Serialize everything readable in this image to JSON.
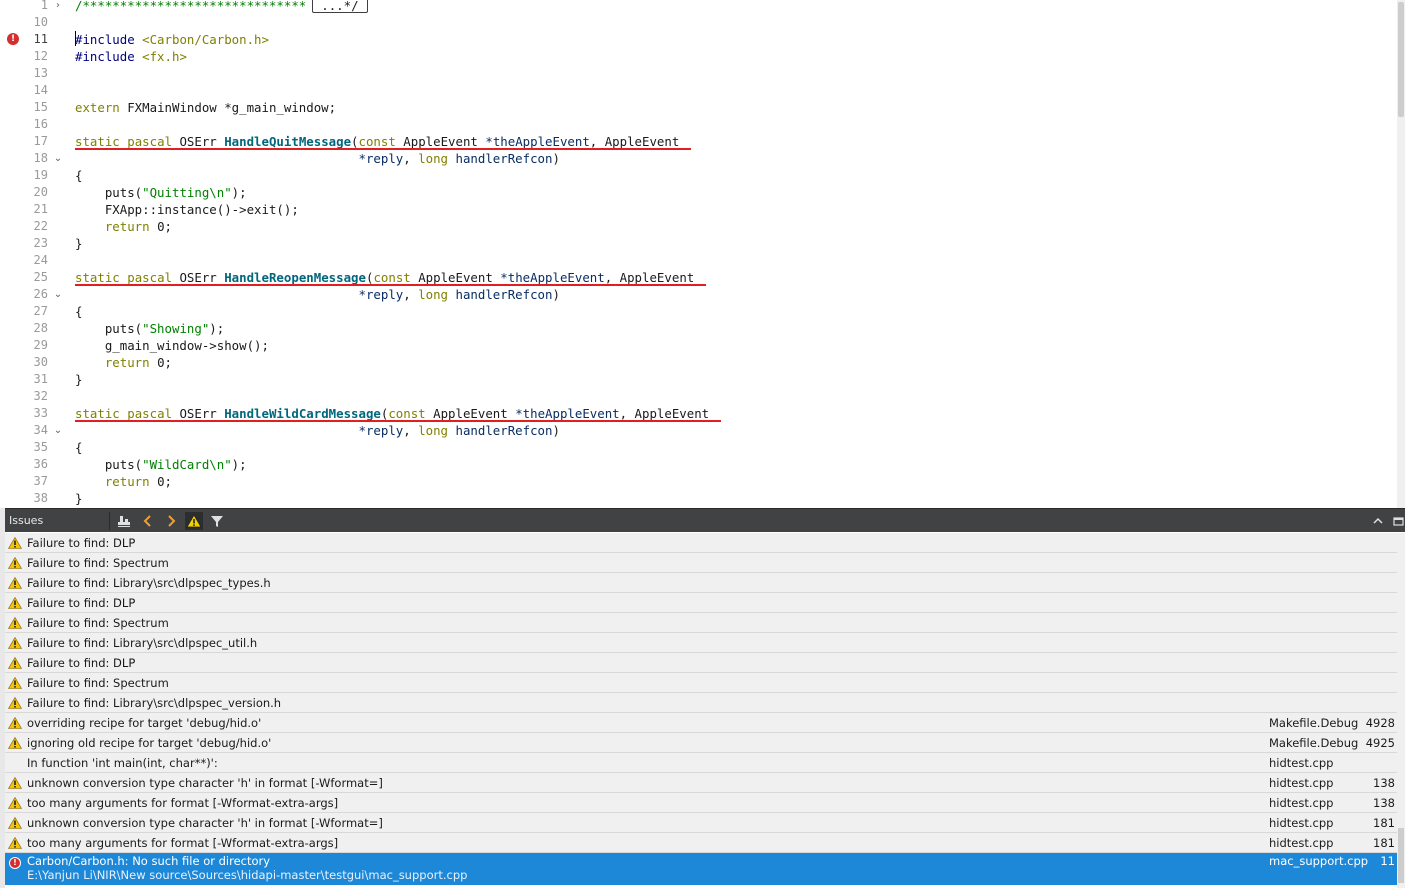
{
  "colors": {
    "comment": "#008000",
    "keyword": "#808000",
    "preprocessor": "#000080",
    "string": "#008000",
    "function": "#00677c",
    "param": "#092e64",
    "error": "#e02020",
    "warning": "#f0a030",
    "selection": "#1e88d8",
    "panel_bar": "#404244"
  },
  "editor": {
    "current_line": "11",
    "error_line": "11",
    "lines": [
      {
        "n": "1",
        "fold": "›",
        "tokens": [
          [
            "comment",
            "/******************************"
          ],
          [
            "foldbox",
            "...*/"
          ]
        ]
      },
      {
        "n": "10",
        "tokens": []
      },
      {
        "n": "11",
        "tokens": [
          [
            "pre",
            "#include "
          ],
          [
            "kw",
            "<Carbon/Carbon.h>"
          ]
        ]
      },
      {
        "n": "12",
        "tokens": [
          [
            "pre",
            "#include "
          ],
          [
            "kw",
            "<fx.h>"
          ]
        ]
      },
      {
        "n": "13",
        "tokens": []
      },
      {
        "n": "14",
        "tokens": []
      },
      {
        "n": "15",
        "tokens": [
          [
            "kw",
            "extern"
          ],
          [
            "plain",
            " FXMainWindow "
          ],
          [
            "plain",
            "*g_main_window;"
          ]
        ]
      },
      {
        "n": "16",
        "tokens": []
      },
      {
        "n": "17",
        "tokens": [
          [
            "kw",
            "static"
          ],
          [
            "plain",
            " "
          ],
          [
            "kw",
            "pascal"
          ],
          [
            "plain",
            " OSErr "
          ],
          [
            "func",
            "HandleQuitMessage"
          ],
          [
            "plain",
            "("
          ],
          [
            "kw",
            "const"
          ],
          [
            "plain",
            " AppleEvent "
          ],
          [
            "param",
            "*theAppleEvent"
          ],
          [
            "plain",
            ", AppleEvent "
          ]
        ]
      },
      {
        "n": "18",
        "fold": "⌄",
        "tokens": [
          [
            "plain",
            "                                      "
          ],
          [
            "param",
            "*reply"
          ],
          [
            "plain",
            ", "
          ],
          [
            "kw",
            "long"
          ],
          [
            "plain",
            " "
          ],
          [
            "param",
            "handlerRefcon"
          ],
          [
            "plain",
            ")"
          ]
        ]
      },
      {
        "n": "19",
        "tokens": [
          [
            "plain",
            "{"
          ]
        ]
      },
      {
        "n": "20",
        "tokens": [
          [
            "plain",
            "    puts("
          ],
          [
            "str",
            "\"Quitting\\n\""
          ],
          [
            "plain",
            ");"
          ]
        ]
      },
      {
        "n": "21",
        "tokens": [
          [
            "plain",
            "    FXApp::instance()->exit();"
          ]
        ]
      },
      {
        "n": "22",
        "tokens": [
          [
            "kw",
            "    return"
          ],
          [
            "plain",
            " 0;"
          ]
        ]
      },
      {
        "n": "23",
        "tokens": [
          [
            "plain",
            "}"
          ]
        ]
      },
      {
        "n": "24",
        "tokens": []
      },
      {
        "n": "25",
        "tokens": [
          [
            "kw",
            "static"
          ],
          [
            "plain",
            " "
          ],
          [
            "kw",
            "pascal"
          ],
          [
            "plain",
            " OSErr "
          ],
          [
            "func",
            "HandleReopenMessage"
          ],
          [
            "plain",
            "("
          ],
          [
            "kw",
            "const"
          ],
          [
            "plain",
            " AppleEvent "
          ],
          [
            "param",
            "*theAppleEvent"
          ],
          [
            "plain",
            ", AppleEvent "
          ]
        ]
      },
      {
        "n": "26",
        "fold": "⌄",
        "tokens": [
          [
            "plain",
            "                                      "
          ],
          [
            "param",
            "*reply"
          ],
          [
            "plain",
            ", "
          ],
          [
            "kw",
            "long"
          ],
          [
            "plain",
            " "
          ],
          [
            "param",
            "handlerRefcon"
          ],
          [
            "plain",
            ")"
          ]
        ]
      },
      {
        "n": "27",
        "tokens": [
          [
            "plain",
            "{"
          ]
        ]
      },
      {
        "n": "28",
        "tokens": [
          [
            "plain",
            "    puts("
          ],
          [
            "str",
            "\"Showing\""
          ],
          [
            "plain",
            ");"
          ]
        ]
      },
      {
        "n": "29",
        "tokens": [
          [
            "plain",
            "    g_main_window->show();"
          ]
        ]
      },
      {
        "n": "30",
        "tokens": [
          [
            "kw",
            "    return"
          ],
          [
            "plain",
            " 0;"
          ]
        ]
      },
      {
        "n": "31",
        "tokens": [
          [
            "plain",
            "}"
          ]
        ]
      },
      {
        "n": "32",
        "tokens": []
      },
      {
        "n": "33",
        "tokens": [
          [
            "kw",
            "static"
          ],
          [
            "plain",
            " "
          ],
          [
            "kw",
            "pascal"
          ],
          [
            "plain",
            " OSErr "
          ],
          [
            "func",
            "HandleWildCardMessage"
          ],
          [
            "plain",
            "("
          ],
          [
            "kw",
            "const"
          ],
          [
            "plain",
            " AppleEvent "
          ],
          [
            "param",
            "*theAppleEvent"
          ],
          [
            "plain",
            ", AppleEvent "
          ]
        ]
      },
      {
        "n": "34",
        "fold": "⌄",
        "tokens": [
          [
            "plain",
            "                                      "
          ],
          [
            "param",
            "*reply"
          ],
          [
            "plain",
            ", "
          ],
          [
            "kw",
            "long"
          ],
          [
            "plain",
            " "
          ],
          [
            "param",
            "handlerRefcon"
          ],
          [
            "plain",
            ")"
          ]
        ]
      },
      {
        "n": "35",
        "tokens": [
          [
            "plain",
            "{"
          ]
        ]
      },
      {
        "n": "36",
        "tokens": [
          [
            "plain",
            "    puts("
          ],
          [
            "str",
            "\"WildCard\\n\""
          ],
          [
            "plain",
            ");"
          ]
        ]
      },
      {
        "n": "37",
        "tokens": [
          [
            "kw",
            "    return"
          ],
          [
            "plain",
            " 0;"
          ]
        ]
      },
      {
        "n": "38",
        "tokens": [
          [
            "plain",
            "}"
          ]
        ]
      }
    ]
  },
  "issues_panel": {
    "title": "Issues",
    "toolbar_icons": [
      "build-issues-icon",
      "prev-icon",
      "next-icon",
      "warnings-filter-icon",
      "filter-icon"
    ],
    "collapse_icon": "chevron-up-icon",
    "items": [
      {
        "type": "warning",
        "desc": "Failure to find: DLP",
        "file": "",
        "line": ""
      },
      {
        "type": "warning",
        "desc": "Failure to find: Spectrum",
        "file": "",
        "line": ""
      },
      {
        "type": "warning",
        "desc": "Failure to find: Library\\src\\dlpspec_types.h",
        "file": "",
        "line": ""
      },
      {
        "type": "warning",
        "desc": "Failure to find: DLP",
        "file": "",
        "line": ""
      },
      {
        "type": "warning",
        "desc": "Failure to find: Spectrum",
        "file": "",
        "line": ""
      },
      {
        "type": "warning",
        "desc": "Failure to find: Library\\src\\dlpspec_util.h",
        "file": "",
        "line": ""
      },
      {
        "type": "warning",
        "desc": "Failure to find: DLP",
        "file": "",
        "line": ""
      },
      {
        "type": "warning",
        "desc": "Failure to find: Spectrum",
        "file": "",
        "line": ""
      },
      {
        "type": "warning",
        "desc": "Failure to find: Library\\src\\dlpspec_version.h",
        "file": "",
        "line": ""
      },
      {
        "type": "warning",
        "desc": "overriding recipe for target 'debug/hid.o'",
        "file": "Makefile.Debug",
        "line": "4928"
      },
      {
        "type": "warning",
        "desc": "ignoring old recipe for target 'debug/hid.o'",
        "file": "Makefile.Debug",
        "line": "4925"
      },
      {
        "type": "info",
        "desc": "In function 'int main(int, char**)':",
        "file": "hidtest.cpp",
        "line": ""
      },
      {
        "type": "warning",
        "desc": "unknown conversion type character 'h' in format [-Wformat=]",
        "file": "hidtest.cpp",
        "line": "138"
      },
      {
        "type": "warning",
        "desc": "too many arguments for format [-Wformat-extra-args]",
        "file": "hidtest.cpp",
        "line": "138"
      },
      {
        "type": "warning",
        "desc": "unknown conversion type character 'h' in format [-Wformat=]",
        "file": "hidtest.cpp",
        "line": "181"
      },
      {
        "type": "warning",
        "desc": "too many arguments for format [-Wformat-extra-args]",
        "file": "hidtest.cpp",
        "line": "181"
      },
      {
        "type": "error",
        "desc": "Carbon/Carbon.h: No such file or directory",
        "path": "E:\\Yanjun Li\\NIR\\New source\\Sources\\hidapi-master\\testgui\\mac_support.cpp",
        "file": "mac_support.cpp",
        "line": "11",
        "selected": true
      }
    ]
  }
}
